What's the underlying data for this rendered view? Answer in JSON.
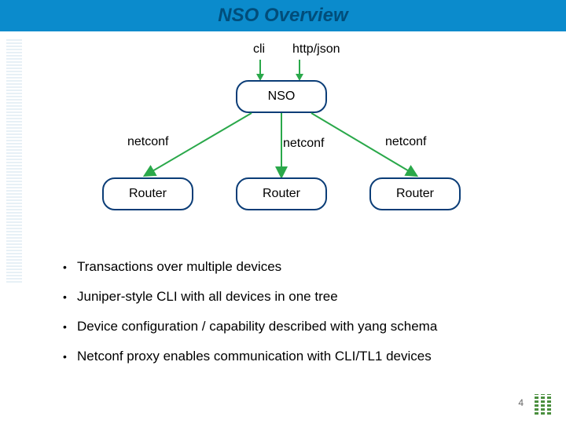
{
  "title": "NSO Overview",
  "top_labels": {
    "cli": "cli",
    "httpjson": "http/json"
  },
  "nodes": {
    "nso": "NSO",
    "router1": "Router",
    "router2": "Router",
    "router3": "Router"
  },
  "edge_labels": {
    "nc1": "netconf",
    "nc2": "netconf",
    "nc3": "netconf"
  },
  "bullets": [
    "Transactions over multiple devices",
    "Juniper-style CLI with all devices in one tree",
    "Device configuration / capability described with yang schema",
    "Netconf proxy enables communication with CLI/TL1 devices"
  ],
  "page_number": "4"
}
